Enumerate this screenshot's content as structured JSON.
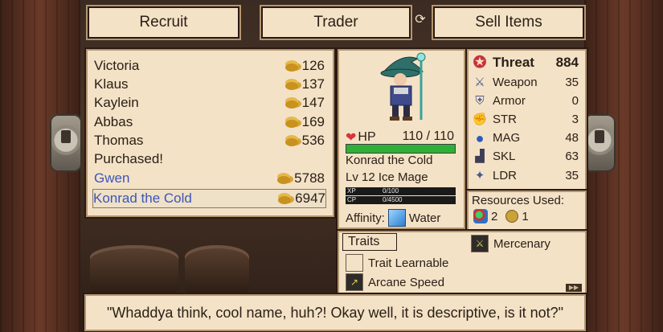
{
  "toolbar": {
    "recruit_label": "Recruit",
    "trader_label": "Trader",
    "sell_label": "Sell Items"
  },
  "recruits": [
    {
      "name": "Victoria",
      "price": "126"
    },
    {
      "name": "Klaus",
      "price": "137"
    },
    {
      "name": "Kaylein",
      "price": "147"
    },
    {
      "name": "Abbas",
      "price": "169"
    },
    {
      "name": "Thomas",
      "price": "536"
    },
    {
      "name": "Purchased!",
      "price": ""
    },
    {
      "name": "Gwen",
      "price": "5788"
    },
    {
      "name": "Konrad the Cold",
      "price": "6947"
    }
  ],
  "unit": {
    "hp_label": "HP",
    "hp_value": "110 / 110",
    "hp_fraction": 1.0,
    "name": "Konrad the Cold",
    "class_line": "Lv 12 Ice Mage",
    "xp_label": "XP",
    "xp_value": "0/100",
    "cp_label": "CP",
    "cp_value": "0/4500",
    "affinity_label": "Affinity:",
    "affinity_value": "Water"
  },
  "stats": {
    "threat_label": "Threat",
    "threat_value": "884",
    "weapon_label": "Weapon",
    "weapon_value": "35",
    "armor_label": "Armor",
    "armor_value": "0",
    "str_label": "STR",
    "str_value": "3",
    "mag_label": "MAG",
    "mag_value": "48",
    "skl_label": "SKL",
    "skl_value": "63",
    "ldr_label": "LDR",
    "ldr_value": "35"
  },
  "resources": {
    "title": "Resources Used:",
    "gems": "2",
    "gold": "1"
  },
  "traits": {
    "tab_label": "Traits",
    "items": [
      "Mercenary",
      "Trait Learnable",
      "Arcane Speed"
    ]
  },
  "dialog": {
    "text": "\"Whaddya think, cool name, huh?! Okay well, it is descriptive, is it not?\""
  },
  "colors": {
    "panel_bg": "#f4e2c7",
    "hp_green": "#2fae38",
    "highlight_blue": "#3d56b8"
  }
}
